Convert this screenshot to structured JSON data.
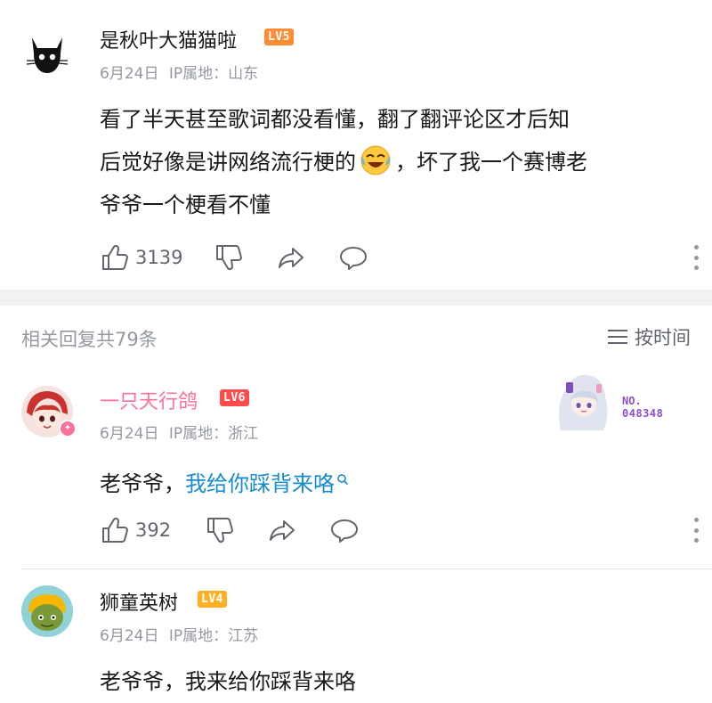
{
  "comment1": {
    "username": "是秋叶大猫猫啦",
    "level": "LV5",
    "date": "6月24日",
    "ip": "IP属地：山东",
    "line1": "看了半天甚至歌词都没看懂，翻了翻评论区才后知",
    "line2a": "后觉好像是讲网络流行梗的",
    "line2b": "，坏了我一个赛博老",
    "line3": "爷爷一个梗看不懂",
    "likes": "3139"
  },
  "reply_header": {
    "count_label": "相关回复共79条",
    "sort_label": "按时间"
  },
  "reply1": {
    "username": "一只天行鸽",
    "level": "LV6",
    "date": "6月24日",
    "ip": "IP属地：浙江",
    "text_prefix": "老爷爷，",
    "text_link": "我给你踩背来咯",
    "likes": "392",
    "badge_label": "NO.",
    "badge_number": "048348"
  },
  "reply2": {
    "username": "狮童英树",
    "level": "LV4",
    "date": "6月24日",
    "ip": "IP属地：江苏",
    "text": "老爷爷，我来给你踩背来咯"
  },
  "colors": {
    "lv5": "#ff8c34",
    "lv6": "#ff4b4b",
    "lv4": "#ffb027",
    "pink_name": "#fb7299",
    "link": "#178bcf",
    "band": "#f1f2f3"
  },
  "icons": [
    "like-icon",
    "dislike-icon",
    "share-icon",
    "comment-icon",
    "more-icon",
    "search-icon",
    "sort-icon"
  ]
}
